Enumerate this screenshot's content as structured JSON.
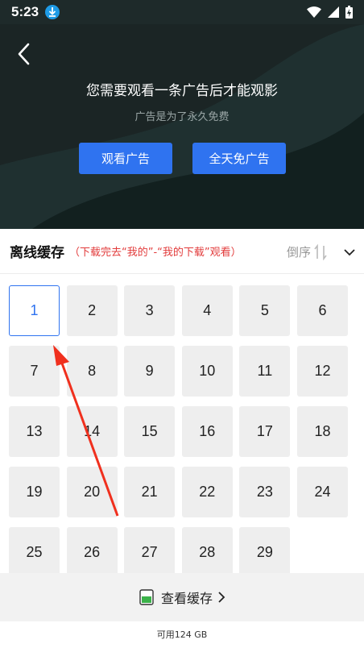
{
  "status": {
    "time": "5:23"
  },
  "banner": {
    "title": "您需要观看一条广告后才能观影",
    "subtitle": "广告是为了永久免费",
    "watch_ad_label": "观看广告",
    "ad_free_label": "全天免广告"
  },
  "offline": {
    "title": "离线缓存",
    "hint": "（下载完去“我的”-“我的下载”观看）",
    "sort_label": "倒序"
  },
  "episodes": [
    "1",
    "2",
    "3",
    "4",
    "5",
    "6",
    "7",
    "8",
    "9",
    "10",
    "11",
    "12",
    "13",
    "14",
    "15",
    "16",
    "17",
    "18",
    "19",
    "20",
    "21",
    "22",
    "23",
    "24",
    "25",
    "26",
    "27",
    "28",
    "29"
  ],
  "selected_episode": "1",
  "bottom": {
    "view_cache_label": "查看缓存",
    "storage_text": "可用124 GB"
  },
  "colors": {
    "accent": "#2f73f0",
    "hint": "#e23b3b",
    "banner_bg": "#1b2626"
  }
}
